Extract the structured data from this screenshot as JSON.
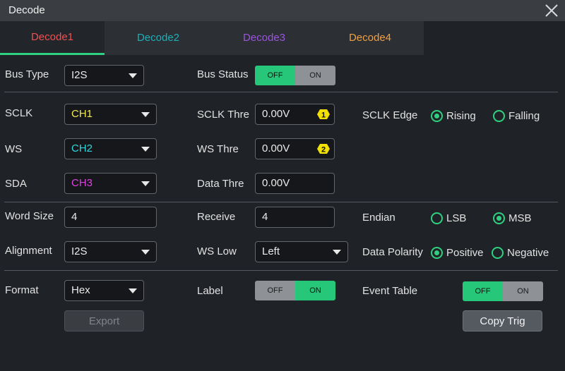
{
  "window": {
    "title": "Decode"
  },
  "tabs": [
    {
      "label": "Decode1",
      "color": "#f05050"
    },
    {
      "label": "Decode2",
      "color": "#1bb0b8"
    },
    {
      "label": "Decode3",
      "color": "#9a54e0"
    },
    {
      "label": "Decode4",
      "color": "#f0a040"
    }
  ],
  "bus": {
    "type_label": "Bus Type",
    "type_value": "I2S",
    "status_label": "Bus Status",
    "status_off": "OFF",
    "status_on": "ON",
    "status_state": "OFF"
  },
  "sclk": {
    "label": "SCLK",
    "source": "CH1",
    "source_color": "#f2e94e",
    "thre_label": "SCLK Thre",
    "thre_value": "0.00V",
    "thre_badge": "1",
    "edge_label": "SCLK Edge",
    "rising": "Rising",
    "falling": "Falling",
    "edge_selected": "Rising"
  },
  "ws": {
    "label": "WS",
    "source": "CH2",
    "source_color": "#2fd8e0",
    "thre_label": "WS Thre",
    "thre_value": "0.00V",
    "thre_badge": "2"
  },
  "sda": {
    "label": "SDA",
    "source": "CH3",
    "source_color": "#e040e0",
    "thre_label": "Data Thre",
    "thre_value": "0.00V"
  },
  "word": {
    "size_label": "Word Size",
    "size_value": "4",
    "receive_label": "Receive",
    "receive_value": "4",
    "endian_label": "Endian",
    "lsb": "LSB",
    "msb": "MSB",
    "endian_selected": "MSB"
  },
  "alignment": {
    "label": "Alignment",
    "value": "I2S",
    "ws_low_label": "WS Low",
    "ws_low_value": "Left",
    "polarity_label": "Data Polarity",
    "positive": "Positive",
    "negative": "Negative",
    "polarity_selected": "Positive"
  },
  "format": {
    "label": "Format",
    "value": "Hex",
    "label_label": "Label",
    "label_off": "OFF",
    "label_on": "ON",
    "label_state": "ON",
    "event_label": "Event Table",
    "event_off": "OFF",
    "event_on": "ON",
    "event_state": "OFF"
  },
  "buttons": {
    "export": "Export",
    "copy_trig": "Copy Trig"
  },
  "icons": {
    "close": "close-icon",
    "caret": "chevron-down-icon",
    "badge": "channel-badge-icon"
  },
  "colors": {
    "accent": "#27c779",
    "badge": "#f2e100"
  }
}
